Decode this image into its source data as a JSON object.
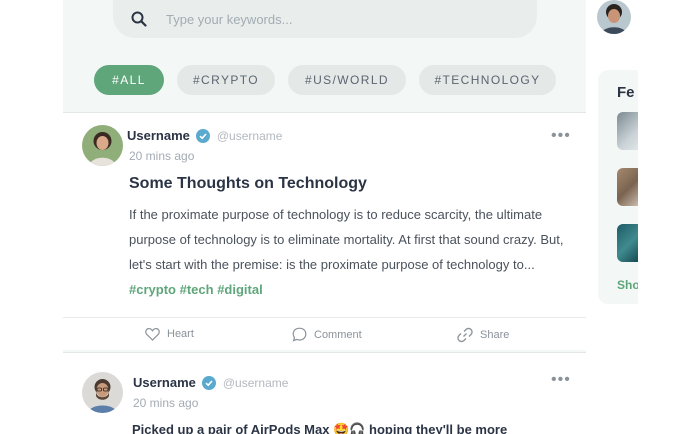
{
  "search": {
    "placeholder": "Type your keywords..."
  },
  "tags": [
    {
      "label": "#ALL",
      "active": true
    },
    {
      "label": "#CRYPTO",
      "active": false
    },
    {
      "label": "#US/WORLD",
      "active": false
    },
    {
      "label": "#TECHNOLOGY",
      "active": false
    }
  ],
  "posts": [
    {
      "username": "Username",
      "handle": "@username",
      "time": "20 mins ago",
      "title": "Some Thoughts on Technology",
      "body": "If the proximate purpose of technology is to reduce scarcity, the ultimate purpose of technology is to eliminate mortality. At first that sound crazy. But, let's start with the premise: is the proximate purpose of technology to...",
      "hashtags": [
        "#crypto",
        "#tech",
        "#digital"
      ],
      "actions": {
        "heart": "Heart",
        "comment": "Comment",
        "share": "Share"
      }
    },
    {
      "username": "Username",
      "handle": "@username",
      "time": "20 mins ago",
      "text": "Picked up a pair of AirPods Max 🤩🎧 hoping they'll be more"
    }
  ],
  "sidebar": {
    "heading": "Fe",
    "show_link": "Sho"
  },
  "colors": {
    "accent": "#5fa67b",
    "verified": "#5aa9cf",
    "panel": "#f3f7f5"
  },
  "icons": {
    "search": "search-icon",
    "verified": "verified-badge-icon",
    "more": "more-dots-icon",
    "heart": "heart-icon",
    "comment": "comment-icon",
    "share": "share-link-icon"
  }
}
